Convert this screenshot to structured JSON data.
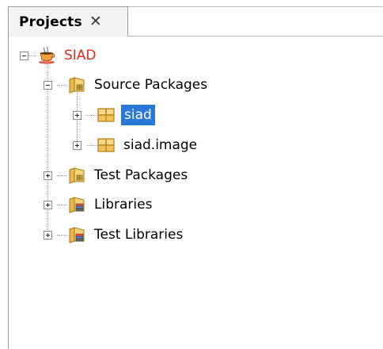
{
  "panel": {
    "tab_label": "Projects",
    "close_glyph": "✕"
  },
  "tree": {
    "project": {
      "label": "SIAD",
      "icon": "coffee-cup-project-icon",
      "color": "#e0271f",
      "expanded": true
    },
    "source_packages": {
      "label": "Source Packages",
      "icon": "source-folder-icon",
      "expanded": true
    },
    "packages": [
      {
        "label": "siad",
        "icon": "package-icon",
        "selected": true,
        "expanded": false
      },
      {
        "label": "siad.image",
        "icon": "package-icon",
        "selected": false,
        "expanded": false
      }
    ],
    "test_packages": {
      "label": "Test Packages",
      "icon": "test-folder-icon",
      "expanded": false
    },
    "libraries": {
      "label": "Libraries",
      "icon": "library-folder-icon",
      "expanded": false
    },
    "test_libraries": {
      "label": "Test Libraries",
      "icon": "library-folder-icon",
      "expanded": false
    }
  },
  "colors": {
    "selection": "#2a79d8",
    "project_text": "#e0271f"
  }
}
